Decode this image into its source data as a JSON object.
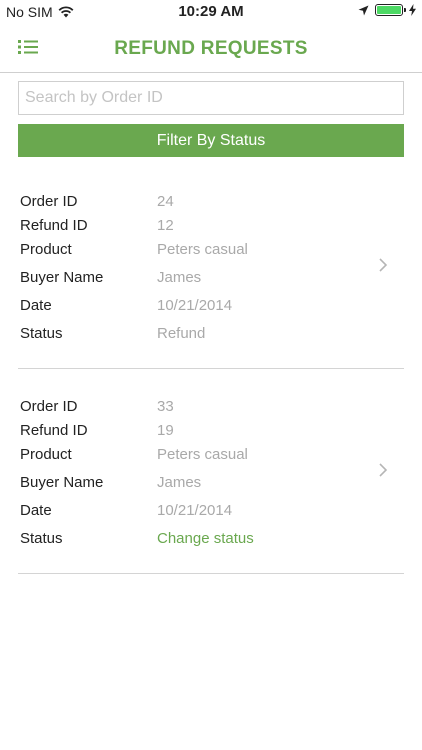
{
  "status_bar": {
    "carrier": "No SIM",
    "time": "10:29 AM",
    "battery_level": 1.0,
    "accent_color": "#4cd964"
  },
  "nav": {
    "title": "REFUND REQUESTS",
    "menu_icon": "list-icon",
    "accent_color": "#6aa84f"
  },
  "search": {
    "placeholder": "Search by Order ID",
    "value": ""
  },
  "filter": {
    "label": "Filter By Status"
  },
  "labels": {
    "order_id": "Order ID",
    "refund_id": "Refund ID",
    "product": "Product",
    "buyer_name": "Buyer Name",
    "date": "Date",
    "status": "Status"
  },
  "requests": [
    {
      "order_id": "24",
      "refund_id": "12",
      "product": "Peters casual",
      "buyer_name": "James",
      "date": "10/21/2014",
      "status": "Refund"
    },
    {
      "order_id": "33",
      "refund_id": "19",
      "product": "Peters casual",
      "buyer_name": "James",
      "date": "10/21/2014",
      "status": "Change status"
    }
  ]
}
